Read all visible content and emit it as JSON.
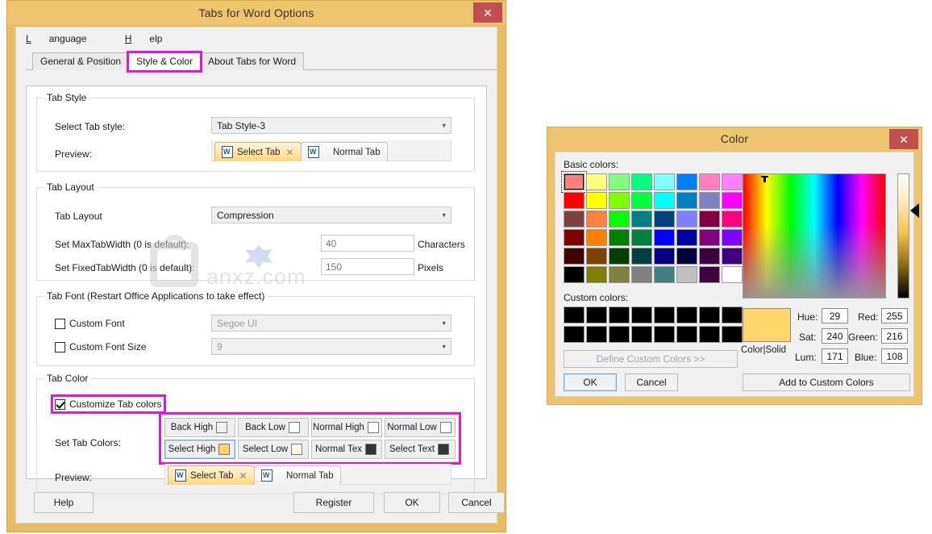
{
  "options_window": {
    "title": "Tabs for Word Options",
    "close_label": "✕",
    "menubar": [
      {
        "acc": "L",
        "rest": "anguage"
      },
      {
        "acc": "H",
        "rest": "elp"
      }
    ],
    "tabs": [
      {
        "label": "General & Position",
        "active": false,
        "highlighted": false
      },
      {
        "label": "Style & Color",
        "active": true,
        "highlighted": true
      },
      {
        "label": "About Tabs for Word",
        "active": false,
        "highlighted": false
      }
    ],
    "tab_style_group": {
      "legend": "Tab Style",
      "select_style_label": "Select Tab style:",
      "select_style_value": "Tab Style-3",
      "preview_label": "Preview:",
      "preview": {
        "select_tab": "Select Tab",
        "normal_tab": "Normal Tab",
        "close_glyph": "✕"
      }
    },
    "tab_layout_group": {
      "legend": "Tab Layout",
      "layout_label": "Tab Layout",
      "layout_value": "Compression",
      "maxwidth_label": "Set MaxTabWidth (0 is default):",
      "maxwidth_value": "40",
      "maxwidth_unit": "Characters",
      "fixedwidth_label": "Set FixedTabWidth (0 is default):",
      "fixedwidth_value": "150",
      "fixedwidth_unit": "Pixels"
    },
    "tab_font_group": {
      "legend": "Tab Font (Restart Office Applications to take effect)",
      "custom_font_label": "Custom Font",
      "custom_font_checked": false,
      "custom_font_value": "Segoe UI",
      "custom_font_size_label": "Custom Font Size",
      "custom_font_size_checked": false,
      "custom_font_size_value": "9"
    },
    "tab_color_group": {
      "legend": "Tab Color",
      "customize_label": "Customize Tab colors",
      "customize_checked": true,
      "set_colors_label": "Set Tab Colors:",
      "preview_label": "Preview:",
      "color_buttons": [
        {
          "label": "Back High",
          "swatch": "#f0f0f0",
          "focus": false
        },
        {
          "label": "Back Low",
          "swatch": "#ffffff",
          "focus": false
        },
        {
          "label": "Normal High",
          "swatch": "#ffffff",
          "focus": false
        },
        {
          "label": "Normal Low",
          "swatch": "#ffffff",
          "focus": false
        },
        {
          "label": "Select High",
          "swatch": "#ffd26c",
          "focus": true
        },
        {
          "label": "Select Low",
          "swatch": "#fffbe8",
          "focus": false
        },
        {
          "label": "Normal Tex",
          "swatch": "#333333",
          "focus": false
        },
        {
          "label": "Select Text",
          "swatch": "#333333",
          "focus": false
        }
      ],
      "preview": {
        "select_tab": "Select Tab",
        "normal_tab": "Normal Tab",
        "close_glyph": "✕"
      }
    },
    "footer_buttons": [
      {
        "label": "Help"
      },
      {
        "label": "Register"
      },
      {
        "label": "OK"
      },
      {
        "label": "Cancel"
      }
    ],
    "highlight_color": "#e018d8"
  },
  "color_dialog": {
    "title": "Color",
    "close_label": "✕",
    "basic_colors_label": "Basic colors:",
    "basic_colors": [
      "#ff8080",
      "#ffff80",
      "#80ff80",
      "#00ff80",
      "#80ffff",
      "#0080ff",
      "#ff80c0",
      "#ff80ff",
      "#ff0000",
      "#ffff00",
      "#80ff00",
      "#00ff40",
      "#00ffff",
      "#0080c0",
      "#8080c0",
      "#ff00ff",
      "#804040",
      "#ff8040",
      "#00ff00",
      "#008080",
      "#004080",
      "#8080ff",
      "#800040",
      "#ff0080",
      "#800000",
      "#ff8000",
      "#008000",
      "#008040",
      "#0000ff",
      "#0000a0",
      "#800080",
      "#8000ff",
      "#400000",
      "#804000",
      "#004000",
      "#004040",
      "#000080",
      "#000040",
      "#400040",
      "#400080",
      "#000000",
      "#808000",
      "#808040",
      "#808080",
      "#408080",
      "#c0c0c0",
      "#400040",
      "#ffffff"
    ],
    "selected_basic_index": 0,
    "custom_colors_label": "Custom colors:",
    "custom_colors": [
      "#000000",
      "#000000",
      "#000000",
      "#000000",
      "#000000",
      "#000000",
      "#000000",
      "#000000",
      "#000000",
      "#000000",
      "#000000",
      "#000000",
      "#000000",
      "#000000",
      "#000000",
      "#000000"
    ],
    "define_custom_label": "Define Custom Colors >>",
    "ok_label": "OK",
    "cancel_label": "Cancel",
    "current_color_label": "Color|Solid",
    "current_color": "#ffd86c",
    "fields": [
      {
        "label": "Hue:",
        "value": "29"
      },
      {
        "label": "Sat:",
        "value": "240"
      },
      {
        "label": "Lum:",
        "value": "171"
      },
      {
        "label": "Red:",
        "value": "255"
      },
      {
        "label": "Green:",
        "value": "216"
      },
      {
        "label": "Blue:",
        "value": "108"
      }
    ],
    "add_custom_label": "Add to Custom Colors"
  },
  "watermark": {
    "text": "anxz.com"
  }
}
